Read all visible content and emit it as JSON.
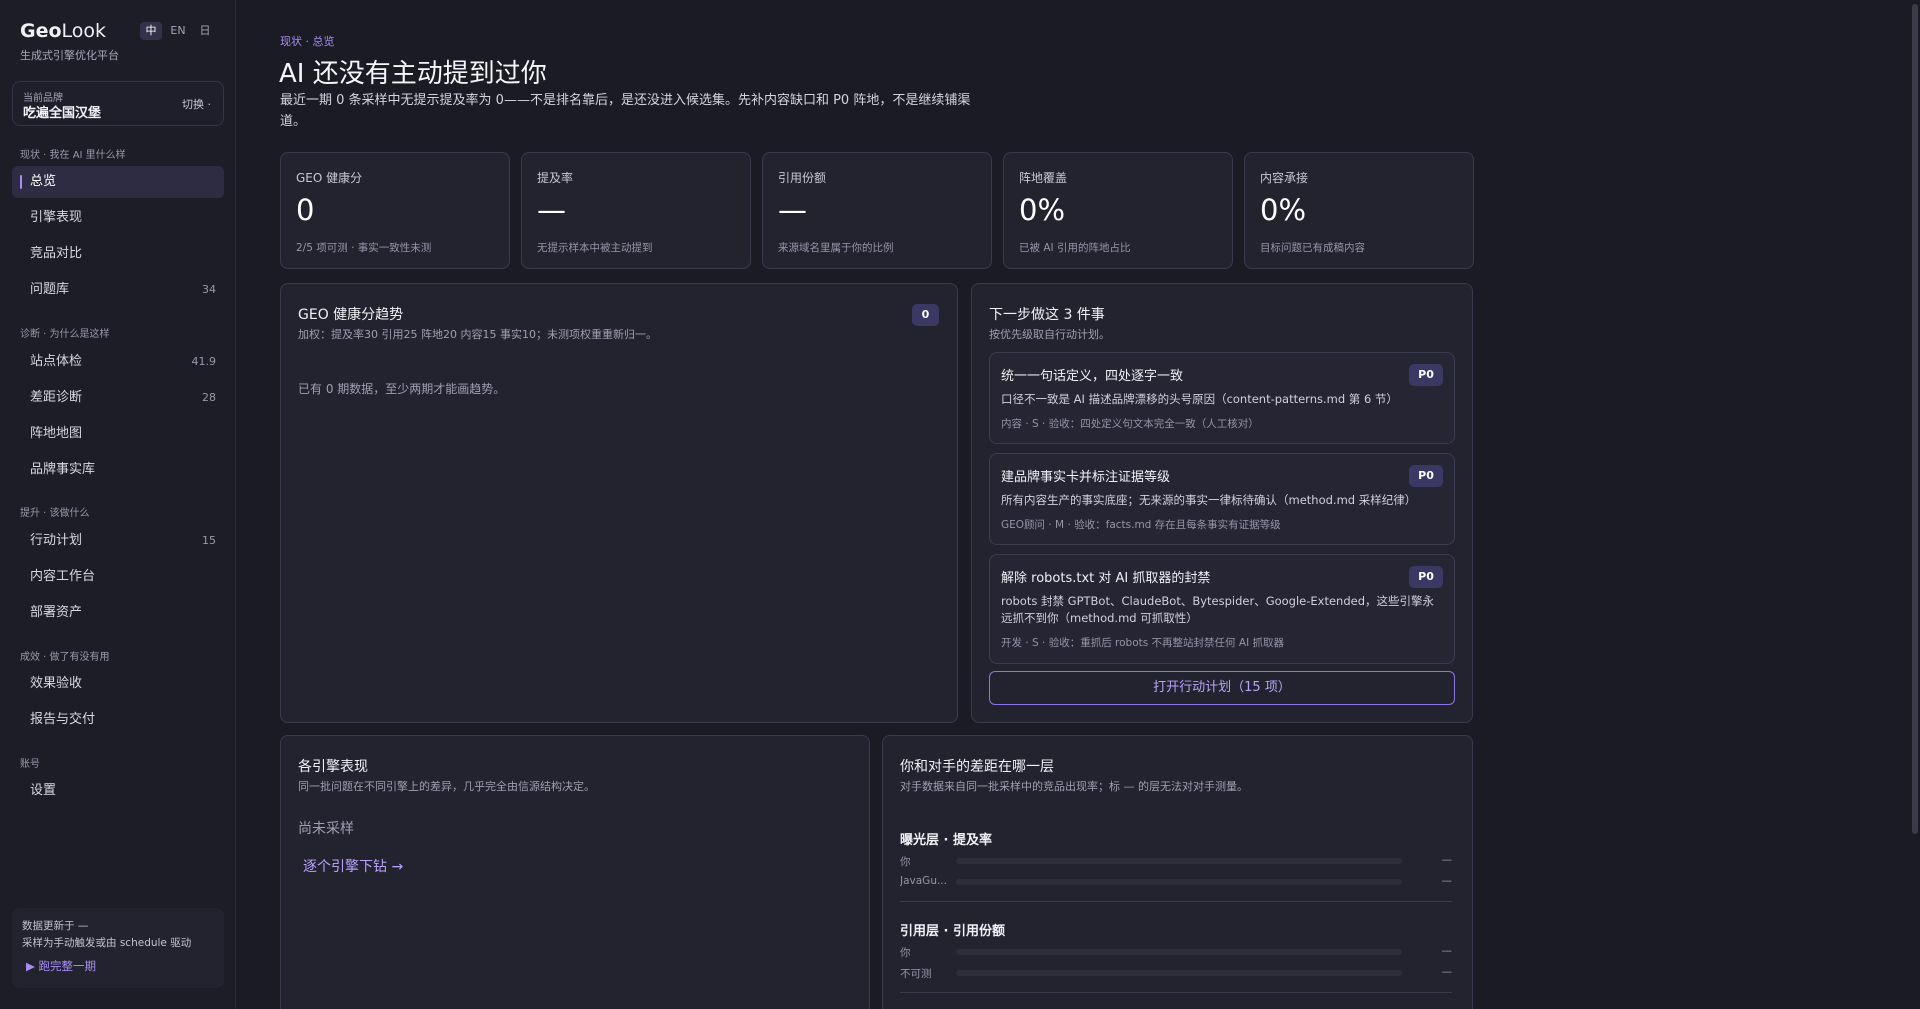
{
  "app": {
    "logo_geo": "Geo",
    "logo_look": "Look",
    "tagline": "生成式引擎优化平台",
    "langs": [
      "中",
      "EN",
      "日"
    ]
  },
  "brand": {
    "caption": "当前品牌",
    "name": "吃遍全国汉堡",
    "switch": "切换 ·"
  },
  "nav": {
    "sections": [
      {
        "label": "现状 · 我在 AI 里什么样"
      },
      {
        "label": "诊断 · 为什么是这样"
      },
      {
        "label": "提升 · 该做什么"
      },
      {
        "label": "成效 · 做了有没有用"
      },
      {
        "label": "账号"
      }
    ],
    "items": [
      {
        "label": "总览",
        "count": ""
      },
      {
        "label": "引擎表现",
        "count": ""
      },
      {
        "label": "竞品对比",
        "count": ""
      },
      {
        "label": "问题库",
        "count": "34"
      },
      {
        "label": "站点体检",
        "count": "41.9"
      },
      {
        "label": "差距诊断",
        "count": "28"
      },
      {
        "label": "阵地地图",
        "count": ""
      },
      {
        "label": "品牌事实库",
        "count": ""
      },
      {
        "label": "行动计划",
        "count": "15"
      },
      {
        "label": "内容工作台",
        "count": ""
      },
      {
        "label": "部署资产",
        "count": ""
      },
      {
        "label": "效果验收",
        "count": ""
      },
      {
        "label": "报告与交付",
        "count": ""
      },
      {
        "label": "设置",
        "count": ""
      }
    ]
  },
  "data_box": {
    "line1": "数据更新于 —",
    "line2": "采样为手动触发或由 schedule 驱动",
    "run": "▶ 跑完整一期"
  },
  "page": {
    "breadcrumb": "现状 · 总览",
    "title": "AI 还没有主动提到过你",
    "subtitle": "最近一期 0 条采样中无提示提及率为 0——不是排名靠后，是还没进入候选集。先补内容缺口和 P0 阵地，不是继续铺渠道。"
  },
  "kpis": [
    {
      "label": "GEO 健康分",
      "value": "0",
      "note": "2/5 项可测 · 事实一致性未测"
    },
    {
      "label": "提及率",
      "value": "—",
      "note": "无提示样本中被主动提到"
    },
    {
      "label": "引用份额",
      "value": "—",
      "note": "来源域名里属于你的比例"
    },
    {
      "label": "阵地覆盖",
      "value": "0%",
      "note": "已被 AI 引用的阵地占比"
    },
    {
      "label": "内容承接",
      "value": "0%",
      "note": "目标问题已有成稿内容"
    }
  ],
  "trend": {
    "title": "GEO 健康分趋势",
    "sub": "加权：提及率30 引用25 阵地20 内容15 事实10；未测项权重重新归一。",
    "badge": "0",
    "empty": "已有 0 期数据，至少两期才能画趋势。"
  },
  "next_steps": {
    "title": "下一步做这 3 件事",
    "sub": "按优先级取自行动计划。",
    "tasks": [
      {
        "title": "统一一句话定义，四处逐字一致",
        "badge": "P0",
        "desc": "口径不一致是 AI 描述品牌漂移的头号原因（content-patterns.md 第 6 节）",
        "meta": "内容 · S · 验收：四处定义句文本完全一致（人工核对）"
      },
      {
        "title": "建品牌事实卡并标注证据等级",
        "badge": "P0",
        "desc": "所有内容生产的事实底座；无来源的事实一律标待确认（method.md 采样纪律）",
        "meta": "GEO顾问 · M · 验收：facts.md 存在且每条事实有证据等级"
      },
      {
        "title": "解除 robots.txt 对 AI 抓取器的封禁",
        "badge": "P0",
        "desc": "robots 封禁 GPTBot、ClaudeBot、Bytespider、Google-Extended，这些引擎永远抓不到你（method.md 可抓取性）",
        "meta": "开发 · S · 验收：重抓后 robots 不再整站封禁任何 AI 抓取器"
      }
    ],
    "button": "打开行动计划（15 项）"
  },
  "engines": {
    "title": "各引擎表现",
    "sub": "同一批问题在不同引擎上的差异，几乎完全由信源结构决定。",
    "empty": "尚未采样",
    "link": "逐个引擎下钻 →"
  },
  "gap": {
    "title": "你和对手的差距在哪一层",
    "sub": "对手数据来自同一批采样中的竞品出现率；标 — 的层无法对对手测量。",
    "layers": [
      {
        "title": "曝光层 · 提及率",
        "rows": [
          {
            "label": "你",
            "value": "—",
            "fill": 0
          },
          {
            "label": "JavaGu...",
            "value": "—",
            "fill": 0
          }
        ]
      },
      {
        "title": "引用层 · 引用份额",
        "rows": [
          {
            "label": "你",
            "value": "—",
            "fill": 0
          },
          {
            "label": "不可测",
            "value": "—",
            "fill": 0
          }
        ]
      }
    ]
  }
}
